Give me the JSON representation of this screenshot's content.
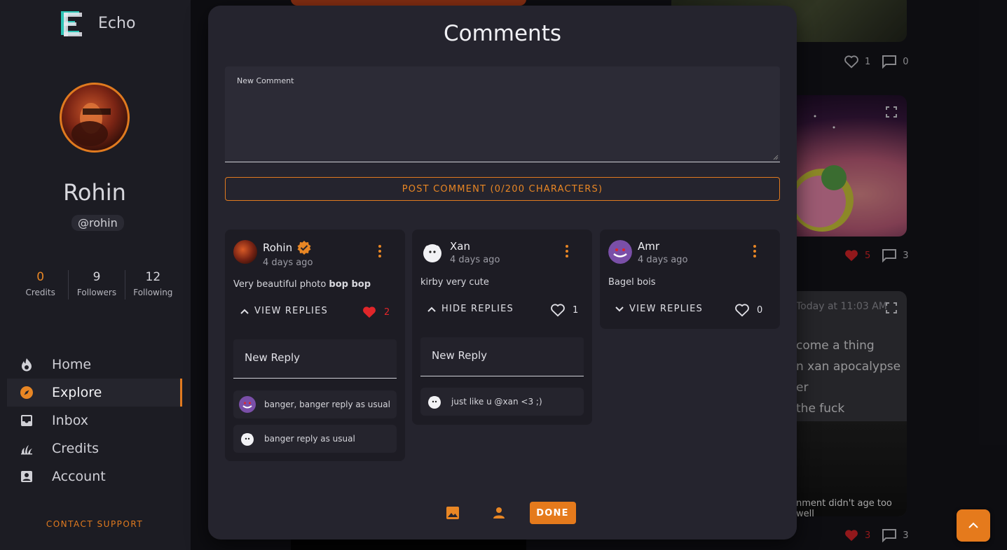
{
  "sidebar": {
    "brand": "Echo",
    "profile": {
      "name": "Rohin",
      "handle": "@rohin"
    },
    "stats": [
      {
        "value": "0",
        "label": "Credits"
      },
      {
        "value": "9",
        "label": "Followers"
      },
      {
        "value": "12",
        "label": "Following"
      }
    ],
    "nav": [
      {
        "label": "Home",
        "icon": "fire-icon"
      },
      {
        "label": "Explore",
        "icon": "compass-icon",
        "active": true
      },
      {
        "label": "Inbox",
        "icon": "inbox-icon"
      },
      {
        "label": "Credits",
        "icon": "grass-icon"
      },
      {
        "label": "Account",
        "icon": "account-box-icon"
      }
    ],
    "contact_support": "CONTACT SUPPORT"
  },
  "feed": {
    "post1": {
      "likes": "1",
      "comments": "0"
    },
    "post2": {
      "likes": "5",
      "comments": "3"
    },
    "post3": {
      "likes": "3",
      "comments": "3",
      "timestamp": "Today at 11:03 AM",
      "lines": [
        "come a thing",
        "n xan apocalypse",
        "er",
        "the fuck"
      ],
      "caption": "nment didn't age too well"
    }
  },
  "modal": {
    "title": "Comments",
    "new_comment_label": "New Comment",
    "post_button": "POST COMMENT (0/200 CHARACTERS)",
    "comments": [
      {
        "author": "Rohin",
        "verified": true,
        "time": "4 days ago",
        "text_prefix": "Very beautiful photo ",
        "text_bold": "bop bop",
        "replies_toggle": "VIEW REPLIES",
        "likes": "2",
        "liked": true,
        "reply_placeholder": "New Reply",
        "replies": [
          {
            "text": "banger, banger reply as usual",
            "avatar": "gengar"
          },
          {
            "text": "banger reply as usual",
            "avatar": "ghost"
          }
        ]
      },
      {
        "author": "Xan",
        "verified": false,
        "time": "4 days ago",
        "text": "kirby very cute",
        "replies_toggle": "HIDE REPLIES",
        "likes": "1",
        "liked": false,
        "reply_placeholder": "New Reply",
        "replies": [
          {
            "text": "just like u @xan <3 ;)",
            "avatar": "ghost"
          }
        ]
      },
      {
        "author": "Amr",
        "verified": false,
        "time": "4 days ago",
        "text": "Bagel bois",
        "replies_toggle": "VIEW REPLIES",
        "likes": "0",
        "liked": false
      }
    ],
    "done_button": "DONE"
  },
  "colors": {
    "accent": "#e57a1c",
    "like_red": "#e0262a",
    "modal_bg": "#25242e",
    "card_bg": "#1d1c24"
  }
}
